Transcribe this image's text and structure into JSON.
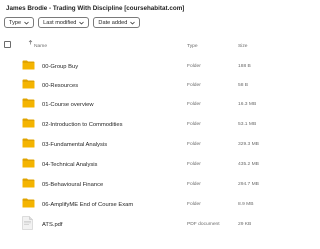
{
  "title": "James Brodie - Trading With Discipline [coursehabitat.com]",
  "filters": [
    {
      "label": "Type"
    },
    {
      "label": "Last modified"
    },
    {
      "label": "Date added"
    }
  ],
  "columns": {
    "name": "Name",
    "type": "Type",
    "size": "Size"
  },
  "files": [
    {
      "name": "00-Group Buy",
      "type": "Folder",
      "size": "188 B",
      "icon": "folder-icon"
    },
    {
      "name": "00-Resources",
      "type": "Folder",
      "size": "58 B",
      "icon": "folder-icon"
    },
    {
      "name": "01-Course overview",
      "type": "Folder",
      "size": "16.3 MB",
      "icon": "folder-icon"
    },
    {
      "name": "02-Introduction to Commodities",
      "type": "Folder",
      "size": "53.1 MB",
      "icon": "folder-icon"
    },
    {
      "name": "03-Fundamental Analysis",
      "type": "Folder",
      "size": "329.3 MB",
      "icon": "folder-icon"
    },
    {
      "name": "04-Technical Analysis",
      "type": "Folder",
      "size": "435.2 MB",
      "icon": "folder-icon"
    },
    {
      "name": "05-Behavioural Finance",
      "type": "Folder",
      "size": "294.7 MB",
      "icon": "folder-icon"
    },
    {
      "name": "06-AmplifyME End of Course Exam",
      "type": "Folder",
      "size": "8.9 MB",
      "icon": "folder-icon"
    },
    {
      "name": "ATS.pdf",
      "type": "PDF document",
      "size": "29 KB",
      "icon": "pdf-icon"
    }
  ],
  "colors": {
    "folder": "#f4b400",
    "folder_tab": "#e0a300",
    "muted_text": "#6b6b6b"
  }
}
